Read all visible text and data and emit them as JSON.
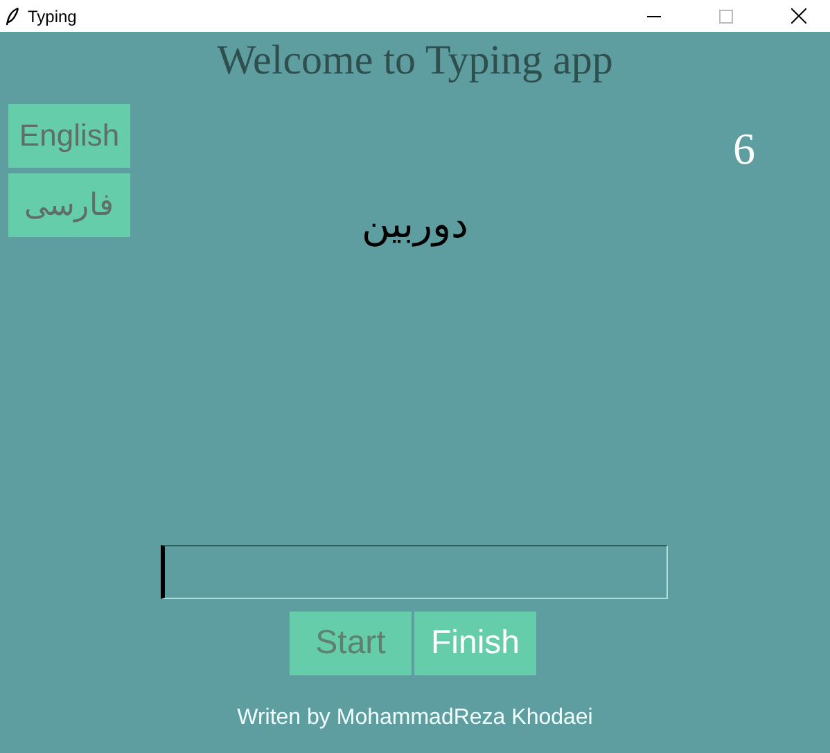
{
  "window": {
    "title": "Typing"
  },
  "heading": "Welcome to Typing app",
  "languages": [
    {
      "label": "English"
    },
    {
      "label": "فارسی"
    }
  ],
  "counter": "6",
  "word": "دوربین",
  "buttons": [
    {
      "label": "Start",
      "disabled": true
    },
    {
      "label": "Finish",
      "disabled": false
    }
  ],
  "footer": "Writen by MohammadReza Khodaei"
}
